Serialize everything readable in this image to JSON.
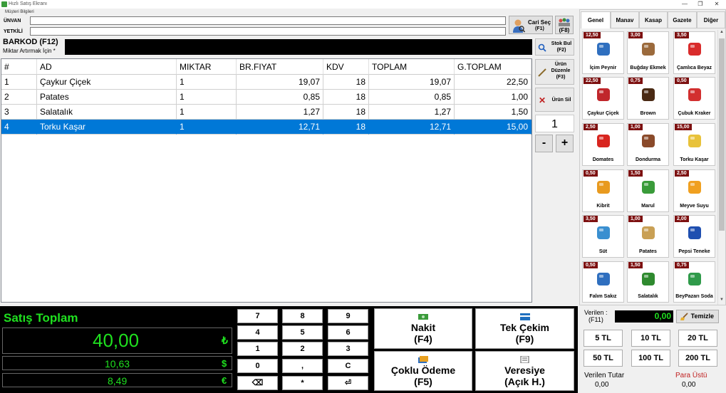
{
  "window": {
    "title": "Hızlı Satış Ekranı",
    "controls": [
      "—",
      "❐",
      "✕"
    ]
  },
  "customer": {
    "group_label": "Müşteri Bilgileri",
    "unvan_label": "ÜNVAN",
    "yetkili_label": "YETKİLİ",
    "unvan_value": "",
    "yetkili_value": "",
    "cari_sec_label": "Cari Seç",
    "cari_sec_key": "(F1)",
    "f8_label": "(F8)"
  },
  "barcode": {
    "label": "BARKOD (F12)",
    "hint": "Miktar Artırmak İçin *",
    "value": ""
  },
  "side_buttons": {
    "stok_bul": "Stok Bul",
    "stok_bul_key": "(F2)",
    "urun_duzenle_1": "Ürün",
    "urun_duzenle_2": "Düzenle",
    "urun_duzenle_key": "(F3)",
    "urun_sil": "Ürün Sil",
    "quantity": "1",
    "minus": "-",
    "plus": "+"
  },
  "grid": {
    "columns": [
      "#",
      "AD",
      "MIKTAR",
      "BR.FIYAT",
      "KDV",
      "TOPLAM",
      "G.TOPLAM"
    ],
    "rows": [
      [
        "1",
        "Çaykur Çiçek",
        "1",
        "19,07",
        "18",
        "19,07",
        "22,50"
      ],
      [
        "2",
        "Patates",
        "1",
        "0,85",
        "18",
        "0,85",
        "1,00"
      ],
      [
        "3",
        "Salatalık",
        "1",
        "1,27",
        "18",
        "1,27",
        "1,50"
      ],
      [
        "4",
        "Torku Kaşar",
        "1",
        "12,71",
        "18",
        "12,71",
        "15,00"
      ]
    ],
    "selected_row": 3
  },
  "totals": {
    "title": "Satış Toplam",
    "total": "40,00",
    "total_currency": "₺",
    "usd": "10,63",
    "usd_currency": "$",
    "eur": "8,49",
    "eur_currency": "€"
  },
  "keypad": [
    "7",
    "8",
    "9",
    "4",
    "5",
    "6",
    "1",
    "2",
    "3",
    "0",
    ",",
    "C",
    "⌫",
    "*",
    "⏎"
  ],
  "payments": {
    "nakit": "Nakit",
    "nakit_key": "(F4)",
    "tek_cekim": "Tek Çekim",
    "tek_cekim_key": "(F9)",
    "coklu": "Çoklu Ödeme",
    "coklu_key": "(F5)",
    "veresiye": "Veresiye",
    "veresiye_key": "(Açık H.)"
  },
  "tabs": [
    "Genel",
    "Manav",
    "Kasap",
    "Gazete",
    "Diğer"
  ],
  "active_tab": 0,
  "products": [
    {
      "price": "12,50",
      "name": "İçim Peynir",
      "icon": "cheese-icon",
      "color": "#2f6fbf"
    },
    {
      "price": "3,00",
      "name": "Buğday Ekmek",
      "icon": "bread-icon",
      "color": "#9b6a3c"
    },
    {
      "price": "3,50",
      "name": "Çamlıca Beyaz",
      "icon": "bottle-icon",
      "color": "#d92b2b"
    },
    {
      "price": "22,50",
      "name": "Çaykur Çiçek",
      "icon": "tea-box-icon",
      "color": "#c0262b"
    },
    {
      "price": "0,75",
      "name": "Brown",
      "icon": "chocolate-icon",
      "color": "#4a2a14"
    },
    {
      "price": "0,50",
      "name": "Çubuk Kraker",
      "icon": "cracker-icon",
      "color": "#d22f2f"
    },
    {
      "price": "2,50",
      "name": "Domates",
      "icon": "tomato-icon",
      "color": "#d8251f"
    },
    {
      "price": "1,00",
      "name": "Dondurma",
      "icon": "ice-cream-icon",
      "color": "#8a4a2a"
    },
    {
      "price": "15,00",
      "name": "Torku Kaşar",
      "icon": "cheese-block-icon",
      "color": "#e8c23a"
    },
    {
      "price": "0,50",
      "name": "Kibrit",
      "icon": "matchbox-icon",
      "color": "#e89a1f"
    },
    {
      "price": "1,50",
      "name": "Marul",
      "icon": "lettuce-icon",
      "color": "#3a9b3a"
    },
    {
      "price": "2,50",
      "name": "Meyve Suyu",
      "icon": "juice-icon",
      "color": "#f0a020"
    },
    {
      "price": "3,50",
      "name": "Süt",
      "icon": "milk-icon",
      "color": "#3a8fd0"
    },
    {
      "price": "1,00",
      "name": "Patates",
      "icon": "potato-icon",
      "color": "#c9a055"
    },
    {
      "price": "2,00",
      "name": "Pepsi Teneke",
      "icon": "can-icon",
      "color": "#1f4fb0"
    },
    {
      "price": "0,50",
      "name": "Falım Sakız",
      "icon": "gum-icon",
      "color": "#2f6fbf"
    },
    {
      "price": "1,50",
      "name": "Salatalık",
      "icon": "cucumber-icon",
      "color": "#2f8a2f"
    },
    {
      "price": "0,75",
      "name": "BeyPazarı Soda",
      "icon": "soda-icon",
      "color": "#2f9a4a"
    }
  ],
  "payment_panel": {
    "verilen_label": "Verilen :",
    "verilen_key": "(F11)",
    "verilen_value": "0,00",
    "temizle": "Temizle",
    "money": [
      "5 TL",
      "10 TL",
      "20 TL",
      "50 TL",
      "100 TL",
      "200 TL"
    ],
    "verilen_tutar_label": "Verilen Tutar",
    "verilen_tutar": "0,00",
    "para_ustu_label": "Para Üstü",
    "para_ustu": "0,00"
  }
}
